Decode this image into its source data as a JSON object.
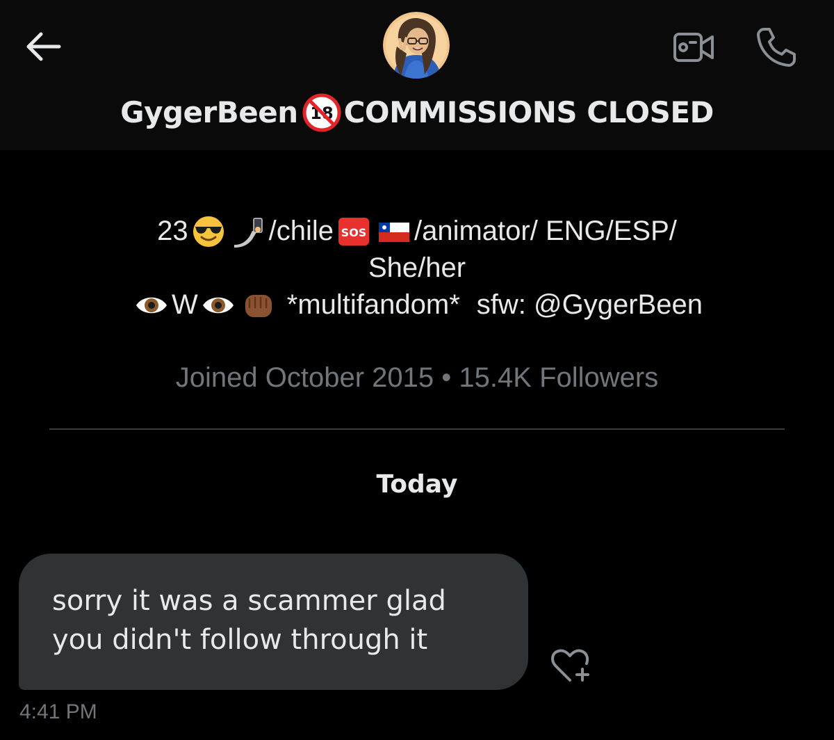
{
  "header": {
    "display_name": "GygerBeen",
    "name_suffix": "COMMISSIONS CLOSED",
    "name_badge_icon": "no-one-under-eighteen-icon",
    "back_icon": "arrow-left-icon",
    "video_call_icon": "video-camera-icon",
    "voice_call_icon": "phone-icon"
  },
  "profile": {
    "bio": {
      "line1": {
        "age": "23",
        "emoji1": "smiling-face-with-sunglasses-icon",
        "emoji2": "selfie-arm-icon",
        "text1": "/chile",
        "emoji3": "sos-button-icon",
        "emoji4": "flag-chile-icon",
        "text2": "/animator/ ENG/ESP/"
      },
      "line2": "She/her",
      "line3": {
        "emoji1": "eye-icon",
        "letter": "W",
        "emoji2": "eye-icon",
        "emoji3": "oncoming-fist-icon",
        "fandom": "*multifandom*",
        "sfw": "sfw: @GygerBeen"
      }
    },
    "joined": "Joined October 2015",
    "separator": "•",
    "followers": "15.4K Followers"
  },
  "conversation": {
    "date_label": "Today",
    "messages": [
      {
        "line1": "sorry it was a scammer glad",
        "line2": "you didn't follow through it",
        "time": "4:41 PM",
        "react_icon": "heart-plus-icon"
      }
    ]
  },
  "colors": {
    "background": "#000000",
    "header_background": "#0a0a0a",
    "primary_text": "#e7e9ea",
    "secondary_text": "#71767b",
    "bubble": "#2f3336",
    "divider": "#3a3d41",
    "icon_gray": "#8b9096"
  }
}
